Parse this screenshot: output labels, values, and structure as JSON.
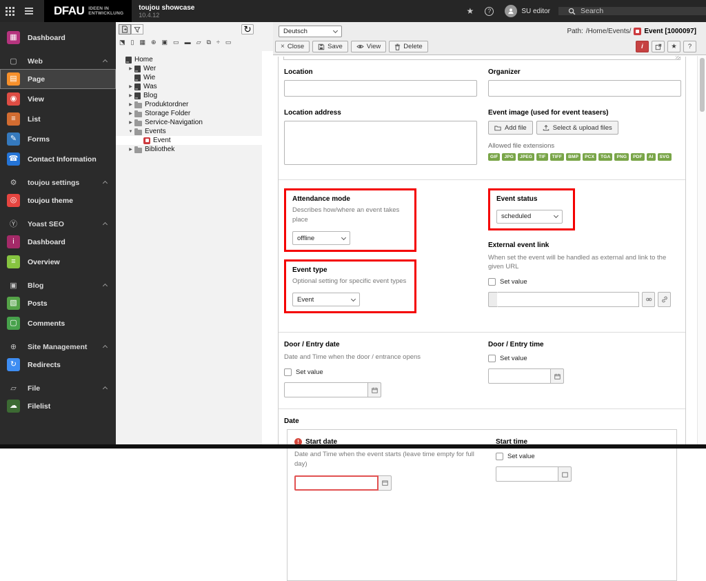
{
  "topbar": {
    "logo_main": "DFAU",
    "logo_sub_line1": "IDEEN IN",
    "logo_sub_line2": "ENTWICKLUNG",
    "product": "toujou showcase",
    "version": "10.4.12",
    "username": "SU editor",
    "search_placeholder": "Search",
    "help_glyph": "?"
  },
  "icons": {
    "star": "★",
    "refresh": "↻",
    "close_x": "×",
    "chevron_collapsed": "▶",
    "chevron_expanded": "▼"
  },
  "module_menu": [
    {
      "type": "item",
      "label": "Dashboard",
      "icon": "dashboard-icon",
      "glyph": "▦",
      "color": "#b5347e"
    },
    {
      "type": "section",
      "label": "Web",
      "icon": "web-doc-icon",
      "glyph": "▢"
    },
    {
      "type": "item",
      "label": "Page",
      "icon": "page-module-icon",
      "glyph": "▤",
      "color": "#f7902b",
      "active": true
    },
    {
      "type": "item",
      "label": "View",
      "icon": "view-eye-icon",
      "glyph": "◉",
      "color": "#de4d44"
    },
    {
      "type": "item",
      "label": "List",
      "icon": "list-module-icon",
      "glyph": "≡",
      "color": "#d26c31"
    },
    {
      "type": "item",
      "label": "Forms",
      "icon": "forms-icon",
      "glyph": "✎",
      "color": "#3579bd"
    },
    {
      "type": "item",
      "label": "Contact Information",
      "icon": "contact-icon",
      "glyph": "☎",
      "color": "#2474d6"
    },
    {
      "type": "section",
      "label": "toujou settings",
      "icon": "gear-icon",
      "glyph": "⚙"
    },
    {
      "type": "item",
      "label": "toujou theme",
      "icon": "fingerprint-icon",
      "glyph": "◎",
      "color": "#e64540"
    },
    {
      "type": "section",
      "label": "Yoast SEO",
      "icon": "yoast-icon",
      "glyph": "Ⓨ"
    },
    {
      "type": "item",
      "label": "Dashboard",
      "icon": "yoast-dashboard-icon",
      "glyph": "i",
      "color": "#a42a68"
    },
    {
      "type": "item",
      "label": "Overview",
      "icon": "overview-icon",
      "glyph": "≡",
      "color": "#86c440"
    },
    {
      "type": "section",
      "label": "Blog",
      "icon": "blog-icon",
      "glyph": "▣"
    },
    {
      "type": "item",
      "label": "Posts",
      "icon": "posts-icon",
      "glyph": "▧",
      "color": "#55a348"
    },
    {
      "type": "item",
      "label": "Comments",
      "icon": "comments-icon",
      "glyph": "▢",
      "color": "#47a14b"
    },
    {
      "type": "section",
      "label": "Site Management",
      "icon": "globe-icon",
      "glyph": "⊕"
    },
    {
      "type": "item",
      "label": "Redirects",
      "icon": "redirects-icon",
      "glyph": "↻",
      "color": "#3e8df2"
    },
    {
      "type": "section",
      "label": "File",
      "icon": "file-section-icon",
      "glyph": "▱"
    },
    {
      "type": "item",
      "label": "Filelist",
      "icon": "filelist-icon",
      "glyph": "☁",
      "color": "#3c6a33"
    }
  ],
  "tree_toolbar_glyphs": [
    "⬔",
    "▯",
    "▦",
    "⊕",
    "▣",
    "▭",
    "▬",
    "▱",
    "⧉",
    "÷",
    "▭"
  ],
  "tree": [
    {
      "label": "Home",
      "level": 0,
      "icon": "page",
      "toggle": "none"
    },
    {
      "label": "Wer",
      "level": 1,
      "icon": "page",
      "toggle": "collapsed"
    },
    {
      "label": "Wie",
      "level": 1,
      "icon": "page",
      "toggle": "none"
    },
    {
      "label": "Was",
      "level": 1,
      "icon": "page",
      "toggle": "collapsed"
    },
    {
      "label": "Blog",
      "level": 1,
      "icon": "page",
      "toggle": "collapsed"
    },
    {
      "label": "Produktordner",
      "level": 1,
      "icon": "folder",
      "toggle": "collapsed"
    },
    {
      "label": "Storage Folder",
      "level": 1,
      "icon": "folder",
      "toggle": "collapsed"
    },
    {
      "label": "Service-Navigation",
      "level": 1,
      "icon": "folder",
      "toggle": "collapsed"
    },
    {
      "label": "Events",
      "level": 1,
      "icon": "folder",
      "toggle": "expanded"
    },
    {
      "label": "Event",
      "level": 2,
      "icon": "event",
      "toggle": "none",
      "selected": true
    },
    {
      "label": "Bibliothek",
      "level": 1,
      "icon": "folder",
      "toggle": "collapsed"
    }
  ],
  "docheader": {
    "language": "Deutsch",
    "close": "Close",
    "save": "Save",
    "view": "View",
    "delete": "Delete",
    "info": "i",
    "help": "?",
    "path_label": "Path:",
    "path": "/Home/Events/",
    "record": "Event [1000097]"
  },
  "form": {
    "location": {
      "label": "Location",
      "value": ""
    },
    "organizer": {
      "label": "Organizer",
      "value": ""
    },
    "location_address": {
      "label": "Location address",
      "value": ""
    },
    "event_image": {
      "label": "Event image (used for event teasers)",
      "add_file": "Add file",
      "select_upload": "Select & upload files",
      "allowed": "Allowed file extensions",
      "extensions": [
        "GIF",
        "JPG",
        "JPEG",
        "TIF",
        "TIFF",
        "BMP",
        "PCX",
        "TGA",
        "PNG",
        "PDF",
        "AI",
        "SVG"
      ]
    },
    "attendance_mode": {
      "label": "Attendance mode",
      "description": "Describes how/where an event takes place",
      "value": "offline"
    },
    "event_status": {
      "label": "Event status",
      "value": "scheduled"
    },
    "event_type": {
      "label": "Event type",
      "description": "Optional setting for specific event types",
      "value": "Event"
    },
    "external_link": {
      "label": "External event link",
      "description": "When set the event will be handled as external and link to the given URL",
      "set_value": "Set value",
      "value": ""
    },
    "door_date": {
      "label": "Door / Entry date",
      "description": "Date and Time when the door / entrance opens",
      "set_value": "Set value",
      "value": ""
    },
    "door_time": {
      "label": "Door / Entry time",
      "set_value": "Set value",
      "value": ""
    },
    "date_group": {
      "label": "Date"
    },
    "start_date": {
      "label": "Start date",
      "description": "Date and Time when the event starts (leave time empty for full day)",
      "value": ""
    },
    "start_time": {
      "label": "Start time",
      "set_value": "Set value",
      "value": ""
    }
  }
}
